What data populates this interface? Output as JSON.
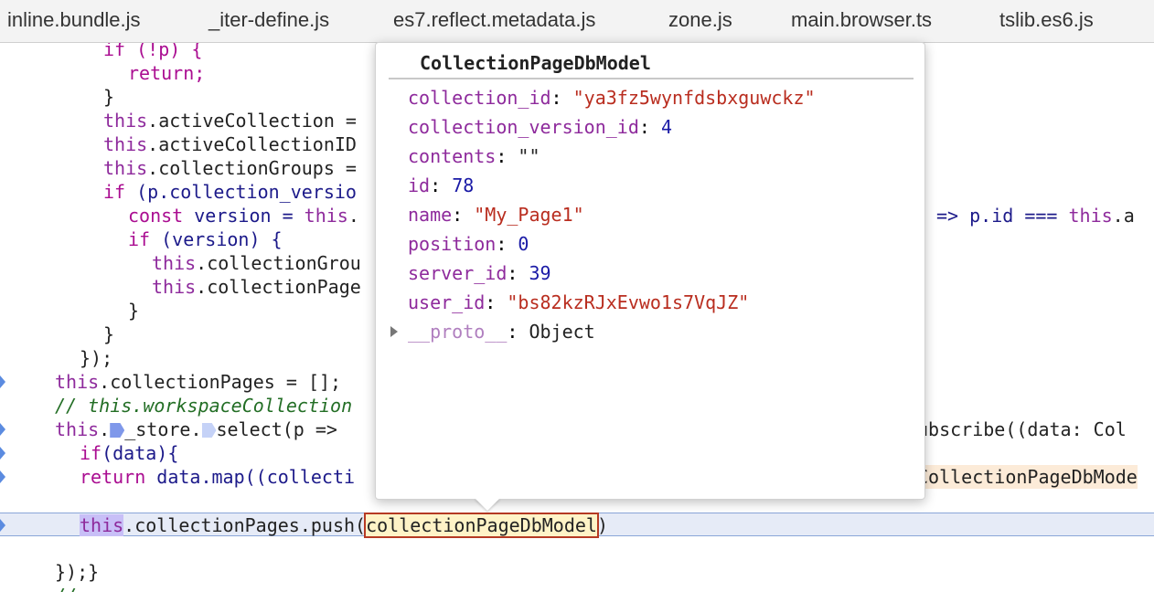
{
  "tabs": [
    {
      "label": "inline.bundle.js"
    },
    {
      "label": "_iter-define.js"
    },
    {
      "label": "es7.reflect.metadata.js"
    },
    {
      "label": "zone.js"
    },
    {
      "label": "main.browser.ts"
    },
    {
      "label": "tslib.es6.js"
    }
  ],
  "code": {
    "l1": "if (!p) {",
    "l2": "return;",
    "l3": "}",
    "l4_obj": "this",
    "l4_rest": ".activeCollection =",
    "l5_obj": "this",
    "l5_rest": ".activeCollectionID",
    "l6_obj": "this",
    "l6_rest": ".collectionGroups =",
    "l7_kw": "if",
    "l7_rest": " (p.collection_versio",
    "l8_kw": "const",
    "l8_mid": " version = ",
    "l8_this": "this",
    "l8_dot": ".",
    "l8_tail_arrow": "=> ",
    "l8_tail_p": "p",
    "l8_tail_id": ".id === ",
    "l8_tail_this": "this",
    "l8_tail_end": ".a",
    "l9_kw": "if",
    "l9_rest": " (version) {",
    "l10_obj": "this",
    "l10_rest": ".collectionGrou",
    "l11_obj": "this",
    "l11_rest": ".collectionPage",
    "l12": "}",
    "l13": "}",
    "l14": "});",
    "l15_obj": "this",
    "l15_rest": ".collectionPages = [];",
    "l16": "// this.workspaceCollection",
    "l17_obj": "this",
    "l17_dot": ".",
    "l17_store": "_store.",
    "l17_select": "select(p =>",
    "l17_right": "ubscribe((data: Col",
    "l18_kw": "if",
    "l18_rest": "(data){",
    "l19_kw": "return",
    "l19_rest": " data.map((collecti",
    "l19_right": "CollectionPageDbMode",
    "l20_this": "this",
    "l20_mid": ".collectionPages.push(",
    "l20_arg": "collectionPageDbModel",
    "l20_end": ")",
    "l21": "});}",
    "l22": "//"
  },
  "popover": {
    "title": "CollectionPageDbModel",
    "props": [
      {
        "key": "collection_id",
        "value": "\"ya3fz5wynfdsbxguwckz\"",
        "kind": "str"
      },
      {
        "key": "collection_version_id",
        "value": "4",
        "kind": "num"
      },
      {
        "key": "contents",
        "value": "\"\"",
        "kind": "plain"
      },
      {
        "key": "id",
        "value": "78",
        "kind": "num"
      },
      {
        "key": "name",
        "value": "\"My_Page1\"",
        "kind": "str"
      },
      {
        "key": "position",
        "value": "0",
        "kind": "num"
      },
      {
        "key": "server_id",
        "value": "39",
        "kind": "num"
      },
      {
        "key": "user_id",
        "value": "\"bs82kzRJxEvwo1s7VqJZ\"",
        "kind": "str"
      }
    ],
    "proto_key": "__proto__",
    "proto_value": "Object"
  }
}
